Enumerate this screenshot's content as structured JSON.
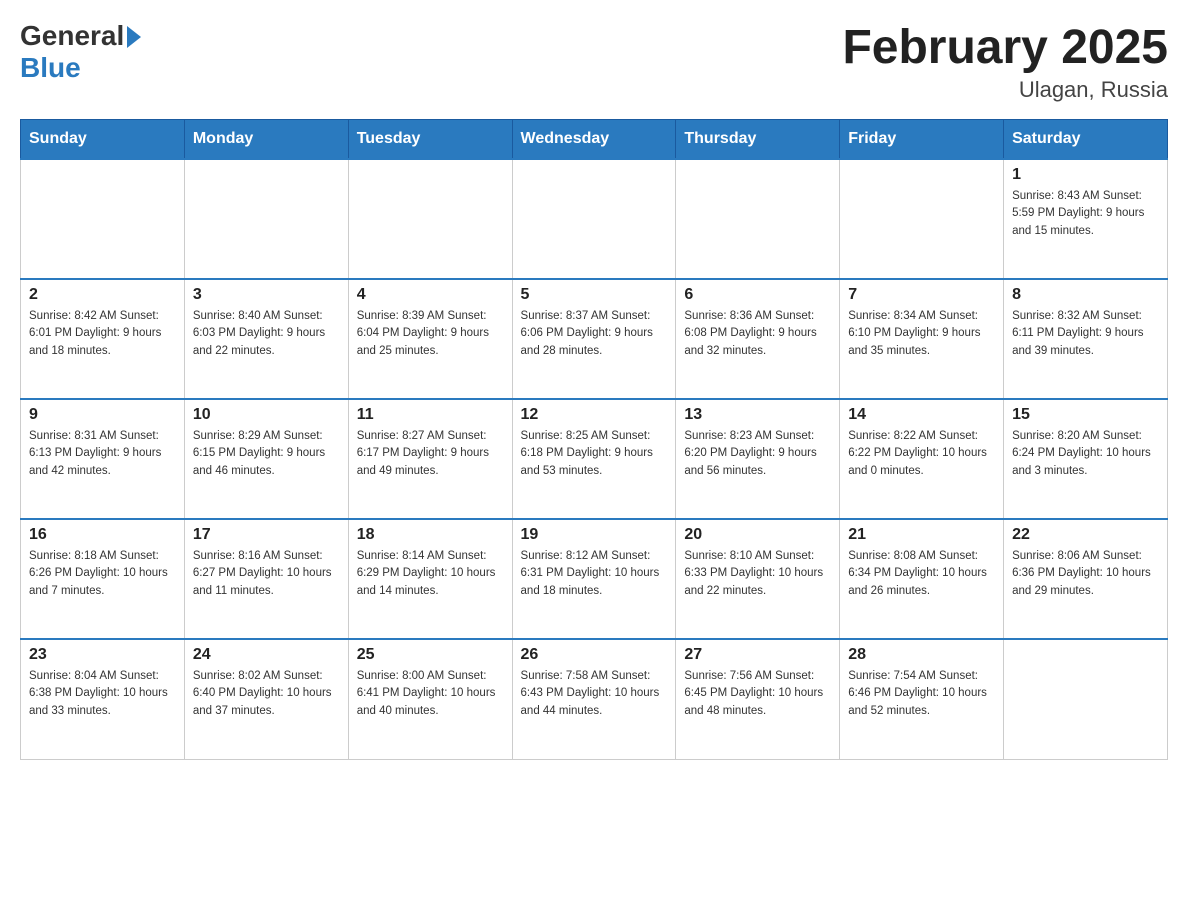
{
  "header": {
    "logo_general": "General",
    "logo_blue": "Blue",
    "month_title": "February 2025",
    "location": "Ulagan, Russia"
  },
  "weekdays": [
    "Sunday",
    "Monday",
    "Tuesday",
    "Wednesday",
    "Thursday",
    "Friday",
    "Saturday"
  ],
  "weeks": [
    [
      {
        "day": "",
        "info": ""
      },
      {
        "day": "",
        "info": ""
      },
      {
        "day": "",
        "info": ""
      },
      {
        "day": "",
        "info": ""
      },
      {
        "day": "",
        "info": ""
      },
      {
        "day": "",
        "info": ""
      },
      {
        "day": "1",
        "info": "Sunrise: 8:43 AM\nSunset: 5:59 PM\nDaylight: 9 hours and 15 minutes."
      }
    ],
    [
      {
        "day": "2",
        "info": "Sunrise: 8:42 AM\nSunset: 6:01 PM\nDaylight: 9 hours and 18 minutes."
      },
      {
        "day": "3",
        "info": "Sunrise: 8:40 AM\nSunset: 6:03 PM\nDaylight: 9 hours and 22 minutes."
      },
      {
        "day": "4",
        "info": "Sunrise: 8:39 AM\nSunset: 6:04 PM\nDaylight: 9 hours and 25 minutes."
      },
      {
        "day": "5",
        "info": "Sunrise: 8:37 AM\nSunset: 6:06 PM\nDaylight: 9 hours and 28 minutes."
      },
      {
        "day": "6",
        "info": "Sunrise: 8:36 AM\nSunset: 6:08 PM\nDaylight: 9 hours and 32 minutes."
      },
      {
        "day": "7",
        "info": "Sunrise: 8:34 AM\nSunset: 6:10 PM\nDaylight: 9 hours and 35 minutes."
      },
      {
        "day": "8",
        "info": "Sunrise: 8:32 AM\nSunset: 6:11 PM\nDaylight: 9 hours and 39 minutes."
      }
    ],
    [
      {
        "day": "9",
        "info": "Sunrise: 8:31 AM\nSunset: 6:13 PM\nDaylight: 9 hours and 42 minutes."
      },
      {
        "day": "10",
        "info": "Sunrise: 8:29 AM\nSunset: 6:15 PM\nDaylight: 9 hours and 46 minutes."
      },
      {
        "day": "11",
        "info": "Sunrise: 8:27 AM\nSunset: 6:17 PM\nDaylight: 9 hours and 49 minutes."
      },
      {
        "day": "12",
        "info": "Sunrise: 8:25 AM\nSunset: 6:18 PM\nDaylight: 9 hours and 53 minutes."
      },
      {
        "day": "13",
        "info": "Sunrise: 8:23 AM\nSunset: 6:20 PM\nDaylight: 9 hours and 56 minutes."
      },
      {
        "day": "14",
        "info": "Sunrise: 8:22 AM\nSunset: 6:22 PM\nDaylight: 10 hours and 0 minutes."
      },
      {
        "day": "15",
        "info": "Sunrise: 8:20 AM\nSunset: 6:24 PM\nDaylight: 10 hours and 3 minutes."
      }
    ],
    [
      {
        "day": "16",
        "info": "Sunrise: 8:18 AM\nSunset: 6:26 PM\nDaylight: 10 hours and 7 minutes."
      },
      {
        "day": "17",
        "info": "Sunrise: 8:16 AM\nSunset: 6:27 PM\nDaylight: 10 hours and 11 minutes."
      },
      {
        "day": "18",
        "info": "Sunrise: 8:14 AM\nSunset: 6:29 PM\nDaylight: 10 hours and 14 minutes."
      },
      {
        "day": "19",
        "info": "Sunrise: 8:12 AM\nSunset: 6:31 PM\nDaylight: 10 hours and 18 minutes."
      },
      {
        "day": "20",
        "info": "Sunrise: 8:10 AM\nSunset: 6:33 PM\nDaylight: 10 hours and 22 minutes."
      },
      {
        "day": "21",
        "info": "Sunrise: 8:08 AM\nSunset: 6:34 PM\nDaylight: 10 hours and 26 minutes."
      },
      {
        "day": "22",
        "info": "Sunrise: 8:06 AM\nSunset: 6:36 PM\nDaylight: 10 hours and 29 minutes."
      }
    ],
    [
      {
        "day": "23",
        "info": "Sunrise: 8:04 AM\nSunset: 6:38 PM\nDaylight: 10 hours and 33 minutes."
      },
      {
        "day": "24",
        "info": "Sunrise: 8:02 AM\nSunset: 6:40 PM\nDaylight: 10 hours and 37 minutes."
      },
      {
        "day": "25",
        "info": "Sunrise: 8:00 AM\nSunset: 6:41 PM\nDaylight: 10 hours and 40 minutes."
      },
      {
        "day": "26",
        "info": "Sunrise: 7:58 AM\nSunset: 6:43 PM\nDaylight: 10 hours and 44 minutes."
      },
      {
        "day": "27",
        "info": "Sunrise: 7:56 AM\nSunset: 6:45 PM\nDaylight: 10 hours and 48 minutes."
      },
      {
        "day": "28",
        "info": "Sunrise: 7:54 AM\nSunset: 6:46 PM\nDaylight: 10 hours and 52 minutes."
      },
      {
        "day": "",
        "info": ""
      }
    ]
  ]
}
